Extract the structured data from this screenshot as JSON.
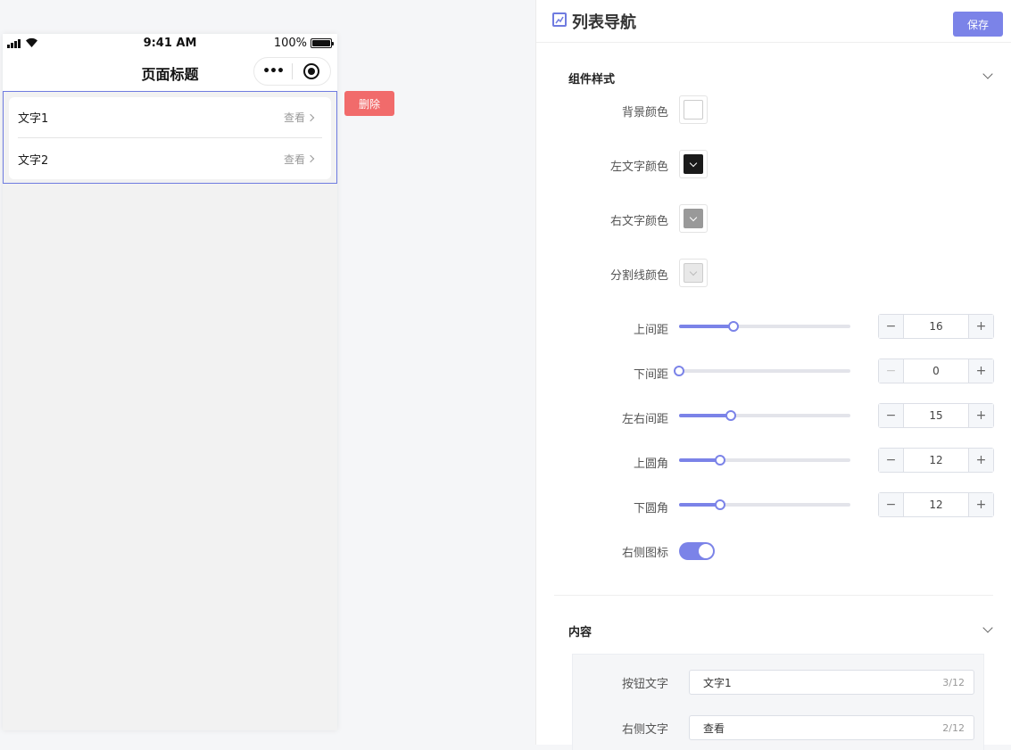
{
  "phone": {
    "status": {
      "time": "9:41 AM",
      "battery": "100%"
    },
    "nav_title": "页面标题",
    "capsule_more": "•••",
    "list_items": [
      {
        "left_text": "文字1",
        "right_text": "查看"
      },
      {
        "left_text": "文字2",
        "right_text": "查看"
      }
    ],
    "delete_label": "删除"
  },
  "panel": {
    "title": "列表导航",
    "save_label": "保存",
    "style_section": {
      "heading": "组件样式",
      "colors": [
        {
          "label": "背景颜色",
          "color": "#ffffff"
        },
        {
          "label": "左文字颜色",
          "color": "#1a1a1a"
        },
        {
          "label": "右文字颜色",
          "color": "#999999"
        },
        {
          "label": "分割线颜色",
          "color": "#e8e8e8"
        }
      ],
      "sliders": [
        {
          "label": "上间距",
          "value": "16",
          "percent": 32,
          "dec_disabled": false
        },
        {
          "label": "下间距",
          "value": "0",
          "percent": 0,
          "dec_disabled": true
        },
        {
          "label": "左右间距",
          "value": "15",
          "percent": 30,
          "dec_disabled": false
        },
        {
          "label": "上圆角",
          "value": "12",
          "percent": 24,
          "dec_disabled": false
        },
        {
          "label": "下圆角",
          "value": "12",
          "percent": 24,
          "dec_disabled": false
        }
      ],
      "toggle_label": "右侧图标",
      "toggle_on": true
    },
    "content_section": {
      "heading": "内容",
      "fields": [
        {
          "label": "按钮文字",
          "value": "文字1",
          "count": "3/12"
        },
        {
          "label": "右侧文字",
          "value": "查看",
          "count": "2/12"
        }
      ]
    }
  }
}
